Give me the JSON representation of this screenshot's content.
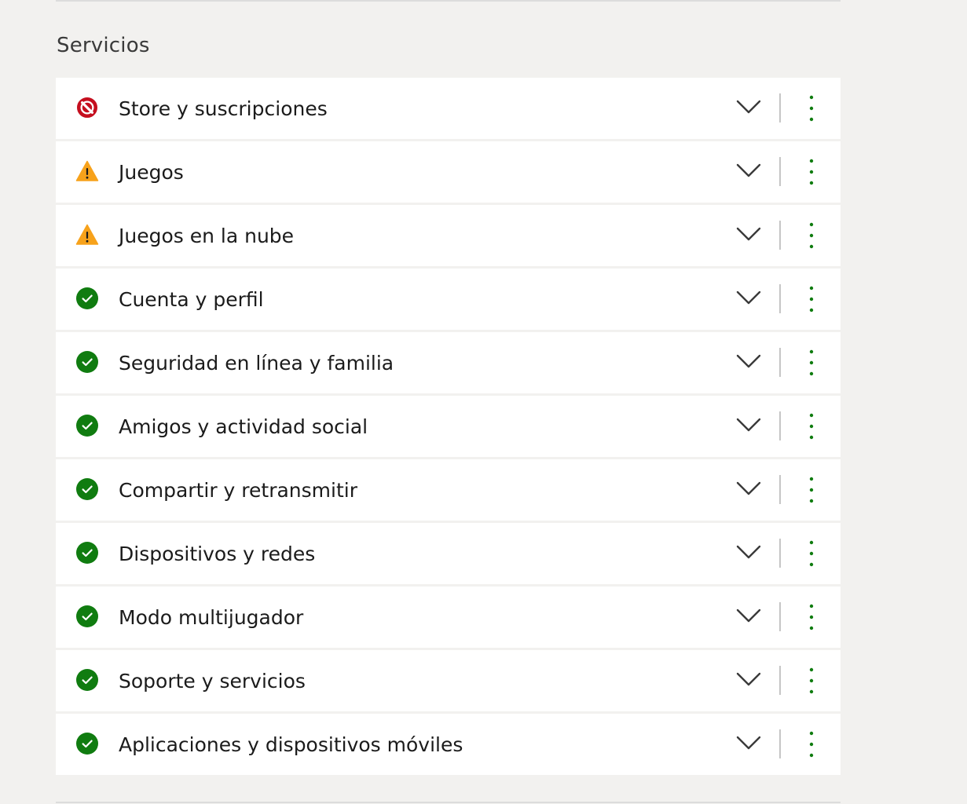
{
  "section": {
    "title": "Servicios"
  },
  "colors": {
    "error": "#c50f1f",
    "warning": "#f7a21b",
    "ok": "#107c10",
    "accent_dots": "#107c10"
  },
  "services": [
    {
      "label": "Store y suscripciones",
      "status": "error",
      "icon": "blocked-icon"
    },
    {
      "label": "Juegos",
      "status": "warning",
      "icon": "warning-icon"
    },
    {
      "label": "Juegos en la nube",
      "status": "warning",
      "icon": "warning-icon"
    },
    {
      "label": "Cuenta y perfil",
      "status": "ok",
      "icon": "check-circle-icon"
    },
    {
      "label": "Seguridad en línea y familia",
      "status": "ok",
      "icon": "check-circle-icon"
    },
    {
      "label": "Amigos y actividad social",
      "status": "ok",
      "icon": "check-circle-icon"
    },
    {
      "label": "Compartir y retransmitir",
      "status": "ok",
      "icon": "check-circle-icon"
    },
    {
      "label": "Dispositivos y redes",
      "status": "ok",
      "icon": "check-circle-icon"
    },
    {
      "label": "Modo multijugador",
      "status": "ok",
      "icon": "check-circle-icon"
    },
    {
      "label": "Soporte y servicios",
      "status": "ok",
      "icon": "check-circle-icon"
    },
    {
      "label": "Aplicaciones y dispositivos móviles",
      "status": "ok",
      "icon": "check-circle-icon"
    }
  ],
  "row_actions": {
    "expand_icon": "chevron-down-icon",
    "more_icon": "more-vertical-icon"
  }
}
